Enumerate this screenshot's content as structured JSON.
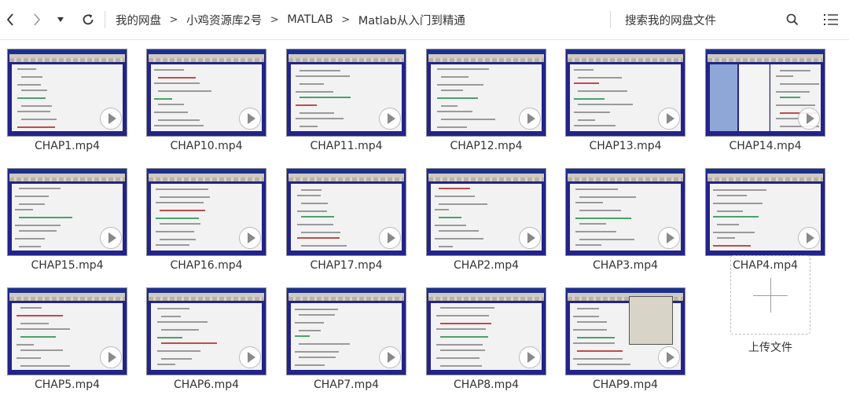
{
  "toolbar": {
    "back_icon": "chevron-left-icon",
    "forward_icon": "chevron-right-icon",
    "dropdown_icon": "caret-down-icon",
    "refresh_icon": "refresh-icon",
    "breadcrumb": [
      "我的网盘",
      "小鸡资源库2号",
      "MATLAB",
      "Matlab从入门到精通"
    ],
    "breadcrumb_separator": ">",
    "search_placeholder": "搜索我的网盘文件",
    "search_icon": "search-icon",
    "view_icon": "list-view-icon"
  },
  "files": [
    {
      "name": "CHAP1.mp4"
    },
    {
      "name": "CHAP10.mp4"
    },
    {
      "name": "CHAP11.mp4"
    },
    {
      "name": "CHAP12.mp4"
    },
    {
      "name": "CHAP13.mp4"
    },
    {
      "name": "CHAP14.mp4"
    },
    {
      "name": "CHAP15.mp4"
    },
    {
      "name": "CHAP16.mp4"
    },
    {
      "name": "CHAP17.mp4"
    },
    {
      "name": "CHAP2.mp4"
    },
    {
      "name": "CHAP3.mp4"
    },
    {
      "name": "CHAP4.mp4"
    },
    {
      "name": "CHAP5.mp4"
    },
    {
      "name": "CHAP6.mp4"
    },
    {
      "name": "CHAP7.mp4"
    },
    {
      "name": "CHAP8.mp4"
    },
    {
      "name": "CHAP9.mp4"
    }
  ],
  "upload": {
    "label": "上传文件",
    "icon": "plus-icon"
  }
}
